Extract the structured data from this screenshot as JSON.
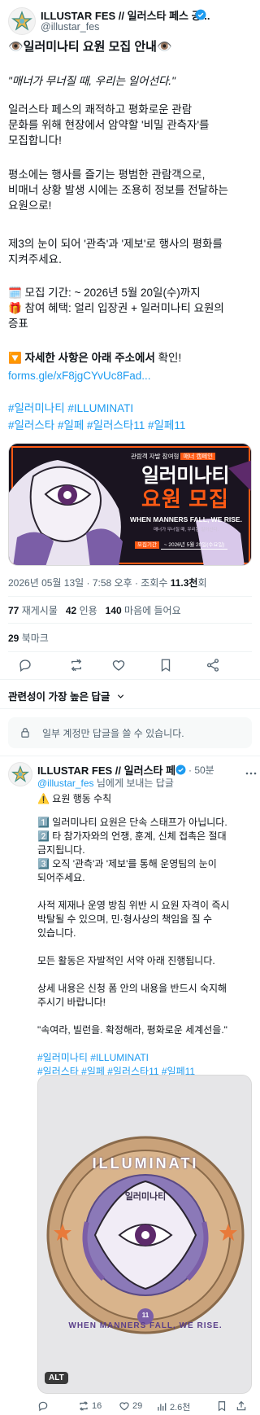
{
  "post": {
    "author_name": "ILLUSTAR FES // 일러스타 페스 공...",
    "author_handle": "@illustar_fes",
    "title": "👁️일러미나티 요원 모집 안내👁️",
    "quote": "\"매너가 무너질 때, 우리는 일어선다.\"",
    "para1_l1": "일러스타 페스의 쾌적하고 평화로운 관람",
    "para1_l2": "문화를 위해 현장에서 암약할 '비밀 관측자'를",
    "para1_l3": "모집합니다!",
    "para2_l1": "평소에는 행사를 즐기는 평범한 관람객으로,",
    "para2_l2": "비매너 상황 발생 시에는 조용히 정보를 전달하는",
    "para2_l3": "요원으로!",
    "para3_l1": "제3의 눈이 되어 '관측'과 '제보'로 행사의 평화를",
    "para3_l2": "지켜주세요.",
    "period": "🗓️ 모집 기간: ~ 2026년 5월 20일(수)까지",
    "benefit_l1": "🎁 참여 혜택: 얼리 입장권 + 일러미나티 요원의",
    "benefit_l2": "증표",
    "detail_bold": "자세한 사항은 아래 주소에서",
    "detail_rest": " 확인!",
    "detail_emoji": "🔽",
    "link": "forms.gle/xF8jgCYvUc8Fad...",
    "tags_l1": "#일러미나티 #ILLUMINATI",
    "tags_l2": "#일러스타 #일페 #일러스타11 #일페11",
    "timestamp": "2026년 05월 13일 · 7:58 오후 · 조회수 ",
    "views": "11.3천",
    "views_suffix": "회",
    "reposts_num": "77",
    "reposts_label": " 재게시물",
    "quotes_num": "42",
    "quotes_label": " 인용",
    "likes_num": "140",
    "likes_label": " 마음에 들어요",
    "bookmarks_num": "29",
    "bookmarks_label": " 북마크"
  },
  "banner": {
    "top_tag": "관람객 자발 참여형",
    "top_tag2": "매너 캠페인",
    "title_l1": "일러미나티",
    "title_l2": "요원 모집",
    "subtitle": "WHEN MANNERS FALL, WE RISE.",
    "sub_ko": "매너가 무너질 때, 우리는 일어선다.",
    "period_label": "모집기간",
    "period_value": "~ 2026년 5월 20일(수요일)"
  },
  "sort": {
    "label": "관련성이 가장 높은 답글"
  },
  "notice": {
    "text": "일부 계정만 답글을 쓸 수 있습니다."
  },
  "reply": {
    "author_name": "ILLUSTAR FES // 일러스타 페...",
    "time": "· 50분",
    "reply_to_handle": "@illustar_fes",
    "reply_to_suffix": " 님에게 보내는 답글",
    "h1": "⚠️ 요원 행동 수칙",
    "r1_l1": "1️⃣ 일러미나티 요원은 단속 스태프가 아닙니다.",
    "r2_l1": "2️⃣ 타 참가자와의 언쟁, 훈계, 신체 접촉은 절대",
    "r2_l2": "금지됩니다.",
    "r3_l1": "3️⃣ 오직 '관측'과 '제보'를 통해 운영팀의 눈이",
    "r3_l2": "되어주세요.",
    "p1_l1": "사적 제재나 운영 방침 위반 시 요원 자격이 즉시",
    "p1_l2": "박탈될 수 있으며, 민·형사상의 책임을 질 수",
    "p1_l3": "있습니다.",
    "p2": "모든 활동은 자발적인 서약 아래 진행됩니다.",
    "p3_l1": "상세 내용은 신청 폼 안의 내용을 반드시 숙지해",
    "p3_l2": "주시기 바랍니다!",
    "p4": "\"속여라, 빌런을. 확정해라, 평화로운 세계선을.\"",
    "tags_l1": "#일러미나티 #ILLUMINATI",
    "tags_l2": "#일러스타 #일페 #일러스타11 #일페11",
    "badge_top": "ILLUMINATI",
    "badge_inner": "일러미나티",
    "badge_bottom": "WHEN MANNERS FALL, WE RISE.",
    "badge_num": "11",
    "alt": "ALT",
    "replies_count": "",
    "reposts_count": "16",
    "likes_count": "29",
    "views_count": "2.6천"
  },
  "colors": {
    "accent": "#1d9bf0",
    "banner_orange": "#ff5a14",
    "banner_bg": "#1a1420"
  }
}
